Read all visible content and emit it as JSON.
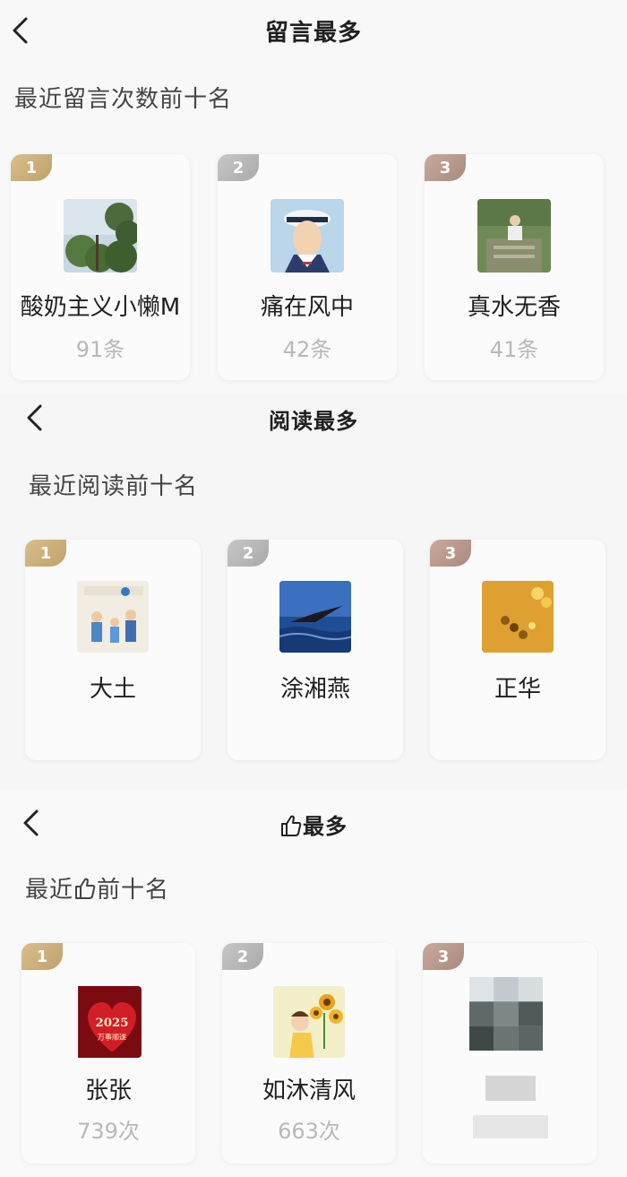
{
  "sections": [
    {
      "title": "留言最多",
      "subtitle": "最近留言次数前十名",
      "cards": [
        {
          "rank": "1",
          "name": "酸奶主义小懒M",
          "count": "91条",
          "avatar": "trees-sky-photo"
        },
        {
          "rank": "2",
          "name": "痛在风中",
          "count": "42条",
          "avatar": "sailor-cartoon"
        },
        {
          "rank": "3",
          "name": "真水无香",
          "count": "41条",
          "avatar": "person-in-garden-photo"
        }
      ]
    },
    {
      "title": "阅读最多",
      "subtitle": "最近阅读前十名",
      "cards": [
        {
          "rank": "1",
          "name": "大土",
          "avatar": "family-illustration"
        },
        {
          "rank": "2",
          "name": "涂湘燕",
          "avatar": "eagle-over-sea"
        },
        {
          "rank": "3",
          "name": "正华",
          "avatar": "gold-coins"
        }
      ]
    },
    {
      "title": "最多",
      "subtitle_a": "最近",
      "subtitle_b": "前十名",
      "cards": [
        {
          "rank": "1",
          "name": "张张",
          "count": "739次",
          "avatar": "red-heart-2025",
          "avatar_text_a": "2025",
          "avatar_text_b": "万事顺遂"
        },
        {
          "rank": "2",
          "name": "如沐清风",
          "count": "663次",
          "avatar": "girl-with-sunflowers"
        },
        {
          "rank": "3",
          "name": "",
          "count": "",
          "avatar": "pixelated-hidden"
        }
      ]
    }
  ],
  "icons": {
    "back": "chevron-left-icon",
    "like": "thumbs-up-icon"
  },
  "colors": {
    "rank1": "#c9ab76",
    "rank2": "#b3b3b3",
    "rank3": "#b8978a",
    "count": "#b8b8b8"
  }
}
